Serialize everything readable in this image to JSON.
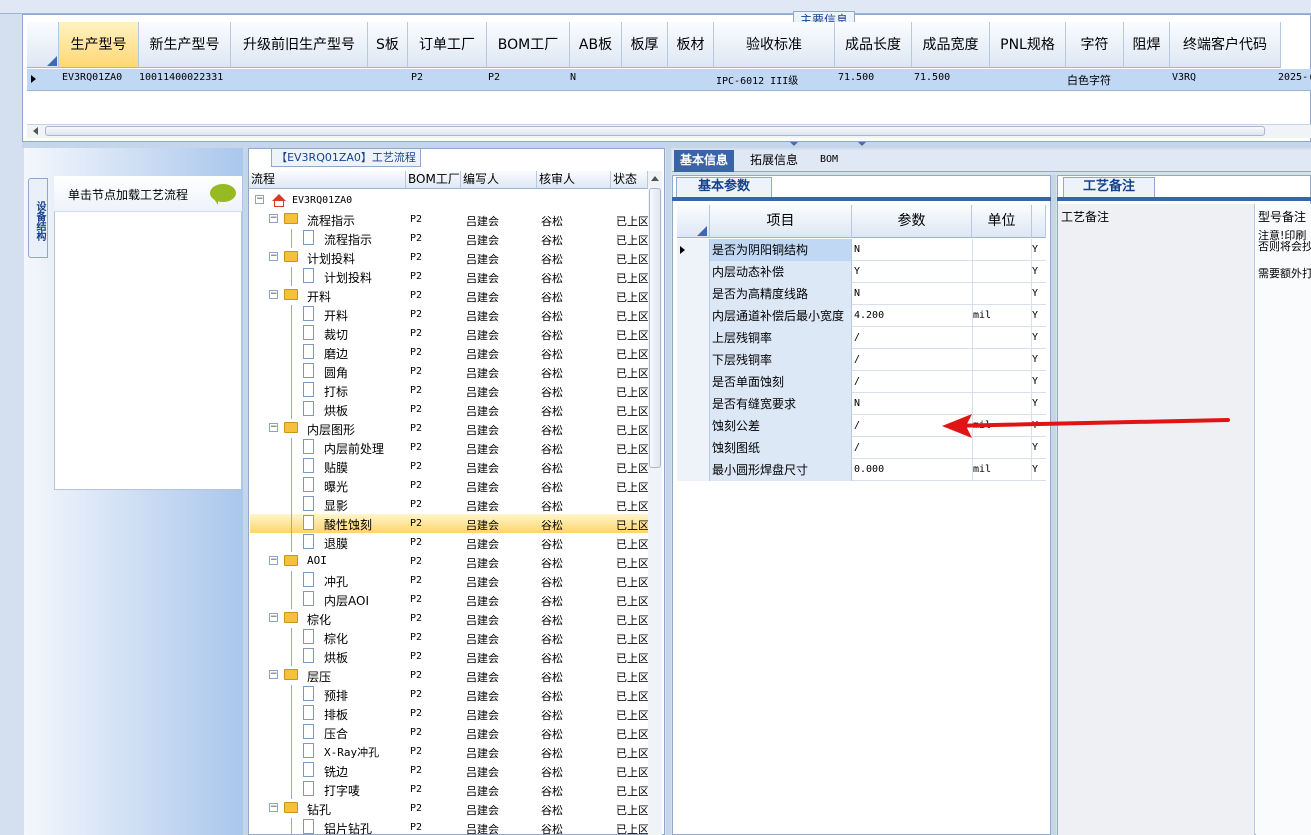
{
  "main_table": {
    "title": "主要信息",
    "columns": [
      "生产型号",
      "新生产型号",
      "升级前旧生产型号",
      "S板",
      "订单工厂",
      "BOM工厂",
      "AB板",
      "板厚",
      "板材",
      "验收标准",
      "成品长度",
      "成品宽度",
      "PNL规格",
      "字符",
      "阻焊",
      "终端客户代码"
    ],
    "row": {
      "production_model": "EV3RQ01ZA0",
      "new_model": "10011400022331",
      "order_factory": "P2",
      "bom_factory": "P2",
      "ab_board": "N",
      "standard": "IPC-6012 III级",
      "length": "71.500",
      "width": "71.500",
      "character": "白色字符",
      "customer_code": "V3RQ",
      "date_partial": "2025-("
    }
  },
  "left_side": {
    "vertical_tab": "设备结构",
    "load_hint": "单击节点加载工艺流程"
  },
  "tree": {
    "title": "【EV3RQ01ZA0】工艺流程",
    "headers": [
      "流程",
      "BOM工厂",
      "编写人",
      "核审人",
      "状态"
    ],
    "root": "EV3RQ01ZA0",
    "rows": [
      {
        "name": "流程指示",
        "type": "folder",
        "level": 1,
        "bom": "P2",
        "writer": "吕建会",
        "reviewer": "谷松",
        "status": "已上区"
      },
      {
        "name": "流程指示",
        "type": "doc",
        "level": 2,
        "bom": "P2",
        "writer": "吕建会",
        "reviewer": "谷松",
        "status": "已上区"
      },
      {
        "name": "计划投料",
        "type": "folder",
        "level": 1,
        "bom": "P2",
        "writer": "吕建会",
        "reviewer": "谷松",
        "status": "已上区"
      },
      {
        "name": "计划投料",
        "type": "doc",
        "level": 2,
        "bom": "P2",
        "writer": "吕建会",
        "reviewer": "谷松",
        "status": "已上区"
      },
      {
        "name": "开料",
        "type": "folder",
        "level": 1,
        "bom": "P2",
        "writer": "吕建会",
        "reviewer": "谷松",
        "status": "已上区"
      },
      {
        "name": "开料",
        "type": "doc",
        "level": 2,
        "bom": "P2",
        "writer": "吕建会",
        "reviewer": "谷松",
        "status": "已上区"
      },
      {
        "name": "裁切",
        "type": "doc",
        "level": 2,
        "bom": "P2",
        "writer": "吕建会",
        "reviewer": "谷松",
        "status": "已上区"
      },
      {
        "name": "磨边",
        "type": "doc",
        "level": 2,
        "bom": "P2",
        "writer": "吕建会",
        "reviewer": "谷松",
        "status": "已上区"
      },
      {
        "name": "圆角",
        "type": "doc",
        "level": 2,
        "bom": "P2",
        "writer": "吕建会",
        "reviewer": "谷松",
        "status": "已上区"
      },
      {
        "name": "打标",
        "type": "doc",
        "level": 2,
        "bom": "P2",
        "writer": "吕建会",
        "reviewer": "谷松",
        "status": "已上区"
      },
      {
        "name": "烘板",
        "type": "doc",
        "level": 2,
        "bom": "P2",
        "writer": "吕建会",
        "reviewer": "谷松",
        "status": "已上区"
      },
      {
        "name": "内层图形",
        "type": "folder",
        "level": 1,
        "bom": "P2",
        "writer": "吕建会",
        "reviewer": "谷松",
        "status": "已上区"
      },
      {
        "name": "内层前处理",
        "type": "doc",
        "level": 2,
        "bom": "P2",
        "writer": "吕建会",
        "reviewer": "谷松",
        "status": "已上区"
      },
      {
        "name": "贴膜",
        "type": "doc",
        "level": 2,
        "bom": "P2",
        "writer": "吕建会",
        "reviewer": "谷松",
        "status": "已上区"
      },
      {
        "name": "曝光",
        "type": "doc",
        "level": 2,
        "bom": "P2",
        "writer": "吕建会",
        "reviewer": "谷松",
        "status": "已上区"
      },
      {
        "name": "显影",
        "type": "doc",
        "level": 2,
        "bom": "P2",
        "writer": "吕建会",
        "reviewer": "谷松",
        "status": "已上区"
      },
      {
        "name": "酸性蚀刻",
        "type": "doc",
        "level": 2,
        "bom": "P2",
        "writer": "吕建会",
        "reviewer": "谷松",
        "status": "已上区",
        "selected": true
      },
      {
        "name": "退膜",
        "type": "doc",
        "level": 2,
        "bom": "P2",
        "writer": "吕建会",
        "reviewer": "谷松",
        "status": "已上区"
      },
      {
        "name": "AOI",
        "type": "folder",
        "level": 1,
        "bom": "P2",
        "writer": "吕建会",
        "reviewer": "谷松",
        "status": "已上区"
      },
      {
        "name": "冲孔",
        "type": "doc",
        "level": 2,
        "bom": "P2",
        "writer": "吕建会",
        "reviewer": "谷松",
        "status": "已上区"
      },
      {
        "name": "内层AOI",
        "type": "doc",
        "level": 2,
        "bom": "P2",
        "writer": "吕建会",
        "reviewer": "谷松",
        "status": "已上区"
      },
      {
        "name": "棕化",
        "type": "folder",
        "level": 1,
        "bom": "P2",
        "writer": "吕建会",
        "reviewer": "谷松",
        "status": "已上区"
      },
      {
        "name": "棕化",
        "type": "doc",
        "level": 2,
        "bom": "P2",
        "writer": "吕建会",
        "reviewer": "谷松",
        "status": "已上区"
      },
      {
        "name": "烘板",
        "type": "doc",
        "level": 2,
        "bom": "P2",
        "writer": "吕建会",
        "reviewer": "谷松",
        "status": "已上区"
      },
      {
        "name": "层压",
        "type": "folder",
        "level": 1,
        "bom": "P2",
        "writer": "吕建会",
        "reviewer": "谷松",
        "status": "已上区"
      },
      {
        "name": "预排",
        "type": "doc",
        "level": 2,
        "bom": "P2",
        "writer": "吕建会",
        "reviewer": "谷松",
        "status": "已上区"
      },
      {
        "name": "排板",
        "type": "doc",
        "level": 2,
        "bom": "P2",
        "writer": "吕建会",
        "reviewer": "谷松",
        "status": "已上区"
      },
      {
        "name": "压合",
        "type": "doc",
        "level": 2,
        "bom": "P2",
        "writer": "吕建会",
        "reviewer": "谷松",
        "status": "已上区"
      },
      {
        "name": "X-Ray冲孔",
        "type": "doc",
        "level": 2,
        "bom": "P2",
        "writer": "吕建会",
        "reviewer": "谷松",
        "status": "已上区"
      },
      {
        "name": "铣边",
        "type": "doc",
        "level": 2,
        "bom": "P2",
        "writer": "吕建会",
        "reviewer": "谷松",
        "status": "已上区"
      },
      {
        "name": "打字唛",
        "type": "doc",
        "level": 2,
        "bom": "P2",
        "writer": "吕建会",
        "reviewer": "谷松",
        "status": "已上区"
      },
      {
        "name": "钻孔",
        "type": "folder",
        "level": 1,
        "bom": "P2",
        "writer": "吕建会",
        "reviewer": "谷松",
        "status": "已上区"
      },
      {
        "name": "铝片钻孔",
        "type": "doc",
        "level": 2,
        "bom": "P2",
        "writer": "吕建会",
        "reviewer": "谷松",
        "status": "已上区"
      }
    ]
  },
  "right_tabs": [
    "基本信息",
    "拓展信息",
    "BOM"
  ],
  "params": {
    "title": "基本参数",
    "headers": [
      "项目",
      "参数",
      "单位"
    ],
    "rows": [
      {
        "name": "是否为阴阳铜结构",
        "value": "N",
        "unit": "",
        "flag": "Y",
        "selected": true
      },
      {
        "name": "内层动态补偿",
        "value": "Y",
        "unit": "",
        "flag": "Y"
      },
      {
        "name": "是否为高精度线路",
        "value": "N",
        "unit": "",
        "flag": "Y"
      },
      {
        "name": "内层通道补偿后最小宽度",
        "value": "4.200",
        "unit": "mil",
        "flag": "Y"
      },
      {
        "name": "上层残铜率",
        "value": "/",
        "unit": "",
        "flag": "Y"
      },
      {
        "name": "下层残铜率",
        "value": "/",
        "unit": "",
        "flag": "Y"
      },
      {
        "name": "是否单面蚀刻",
        "value": "/",
        "unit": "",
        "flag": "Y"
      },
      {
        "name": "是否有缝宽要求",
        "value": "N",
        "unit": "",
        "flag": "Y"
      },
      {
        "name": "蚀刻公差",
        "value": "/",
        "unit": "mil",
        "flag": "Y"
      },
      {
        "name": "蚀刻图纸",
        "value": "/",
        "unit": "",
        "flag": "Y"
      },
      {
        "name": "最小圆形焊盘尺寸",
        "value": "0.000",
        "unit": "mil",
        "flag": "Y"
      }
    ]
  },
  "notes": {
    "title": "工艺备注",
    "col_left": "工艺备注",
    "col_right": "型号备注",
    "line1": "注意!印刷",
    "line2": "否则将会抄",
    "line3": "需要额外打"
  },
  "colors": {
    "accent": "#3a64a8",
    "selected_row": "#ffd56a",
    "arrow": "#e01414"
  }
}
